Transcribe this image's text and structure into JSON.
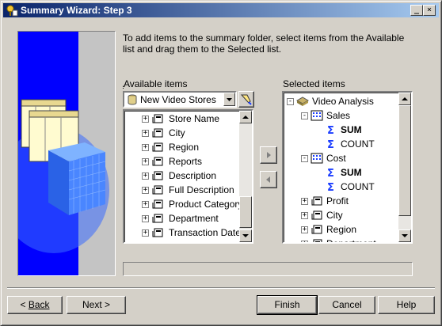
{
  "window": {
    "title": "Summary Wizard: Step 3",
    "controls": {
      "minimize": "_",
      "maximize": "□",
      "close": "×"
    }
  },
  "instructions": "To add items to the summary folder, select items from the Available list and drag them to the Selected list.",
  "available": {
    "label": "Available items",
    "dropdown_value": "New Video Stores",
    "items": [
      "Store Name",
      "City",
      "Region",
      "Reports",
      "Description",
      "Full Description",
      "Product Category",
      "Department",
      "Transaction Date",
      ""
    ]
  },
  "selected": {
    "label": "Selected items",
    "root": "Video Analysis",
    "rows": [
      {
        "level": 1,
        "text": "Sales",
        "type": "folder-open"
      },
      {
        "level": 2,
        "text": "SUM",
        "type": "sum",
        "bold": true
      },
      {
        "level": 2,
        "text": "COUNT",
        "type": "sum",
        "bold": false
      },
      {
        "level": 1,
        "text": "Cost",
        "type": "folder-open"
      },
      {
        "level": 2,
        "text": "SUM",
        "type": "sum",
        "bold": true
      },
      {
        "level": 2,
        "text": "COUNT",
        "type": "sum",
        "bold": false
      },
      {
        "level": 1,
        "text": "Profit",
        "type": "item"
      },
      {
        "level": 1,
        "text": "City",
        "type": "item"
      },
      {
        "level": 1,
        "text": "Region",
        "type": "item"
      },
      {
        "level": 1,
        "text": "Department",
        "type": "item"
      }
    ]
  },
  "buttons": {
    "back": "Back",
    "next": "Next",
    "finish": "Finish",
    "cancel": "Cancel",
    "help": "Help"
  }
}
